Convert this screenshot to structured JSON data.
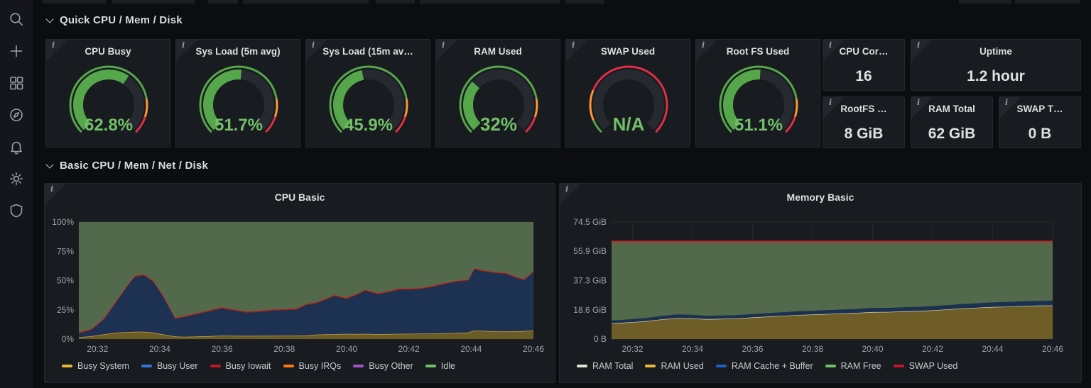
{
  "sidebar": {
    "icons": [
      "search",
      "plus",
      "dashboards",
      "explore",
      "alerting",
      "settings",
      "admin-shield"
    ]
  },
  "sections": [
    {
      "title": "Quick CPU / Mem / Disk"
    },
    {
      "title": "Basic CPU / Mem / Net / Disk"
    }
  ],
  "colors": {
    "gauge_green": "#56A64B",
    "gauge_value_green": "#73BF69",
    "threshold_orange": "#FF9830",
    "threshold_red": "#E02F44",
    "yellow": "#EAB839",
    "blue": "#3274D9",
    "dark_red": "#C4162A",
    "orange": "#FF780A",
    "purple": "#A352CC",
    "green": "#73BF69",
    "cream": "#E0E2CF",
    "panel_bg": "#181b1f",
    "page_bg": "#0b0d10"
  },
  "gauges": [
    {
      "title": "CPU Busy",
      "value": "62.8%",
      "percent": 62.8,
      "thresholds": [
        [
          0,
          80,
          "#56A64B"
        ],
        [
          80,
          90,
          "#FF9830"
        ],
        [
          90,
          100,
          "#E02F44"
        ]
      ]
    },
    {
      "title": "Sys Load (5m avg)",
      "value": "51.7%",
      "percent": 51.7,
      "thresholds": [
        [
          0,
          80,
          "#56A64B"
        ],
        [
          80,
          90,
          "#FF9830"
        ],
        [
          90,
          100,
          "#E02F44"
        ]
      ]
    },
    {
      "title": "Sys Load (15m av…",
      "value": "45.9%",
      "percent": 45.9,
      "thresholds": [
        [
          0,
          80,
          "#56A64B"
        ],
        [
          80,
          90,
          "#FF9830"
        ],
        [
          90,
          100,
          "#E02F44"
        ]
      ]
    },
    {
      "title": "RAM Used",
      "value": "32%",
      "percent": 32,
      "thresholds": [
        [
          0,
          80,
          "#56A64B"
        ],
        [
          80,
          90,
          "#FF9830"
        ],
        [
          90,
          100,
          "#E02F44"
        ]
      ]
    },
    {
      "title": "SWAP Used",
      "value": "N/A",
      "percent": null,
      "thresholds": [
        [
          0,
          8,
          "#56A64B"
        ],
        [
          8,
          25,
          "#FF9830"
        ],
        [
          25,
          100,
          "#E02F44"
        ]
      ]
    },
    {
      "title": "Root FS Used",
      "value": "51.1%",
      "percent": 51.1,
      "thresholds": [
        [
          0,
          80,
          "#56A64B"
        ],
        [
          80,
          90,
          "#FF9830"
        ],
        [
          90,
          100,
          "#E02F44"
        ]
      ]
    }
  ],
  "stats": [
    {
      "title": "CPU Cor…",
      "value": "16"
    },
    {
      "title": "Uptime",
      "value": "1.2 hour"
    },
    {
      "title": "RootFS …",
      "value": "8 GiB"
    },
    {
      "title": "RAM Total",
      "value": "62 GiB"
    },
    {
      "title": "SWAP T…",
      "value": "0 B"
    }
  ],
  "chart_data": [
    {
      "type": "area",
      "title": "CPU Basic",
      "stacked": true,
      "stack_total": 100,
      "ylim": [
        0,
        100
      ],
      "yticks": [
        [
          0,
          "0%"
        ],
        [
          25,
          "25%"
        ],
        [
          50,
          "50%"
        ],
        [
          75,
          "75%"
        ],
        [
          100,
          "100%"
        ]
      ],
      "xticks": [
        [
          32,
          "20:32"
        ],
        [
          34,
          "20:34"
        ],
        [
          36,
          "20:36"
        ],
        [
          38,
          "20:38"
        ],
        [
          40,
          "20:40"
        ],
        [
          42,
          "20:42"
        ],
        [
          44,
          "20:44"
        ],
        [
          46,
          "20:46"
        ]
      ],
      "x_domain": [
        31.4,
        46
      ],
      "x_minutes": [
        31.4,
        31.8,
        32.2,
        32.6,
        33.0,
        33.2,
        33.5,
        33.8,
        34.1,
        34.5,
        34.8,
        35.2,
        35.6,
        36.0,
        36.4,
        36.8,
        37.2,
        37.6,
        38.0,
        38.4,
        38.7,
        39.0,
        39.3,
        39.6,
        40.0,
        40.3,
        40.6,
        41.0,
        41.3,
        41.7,
        42.0,
        42.4,
        42.8,
        43.2,
        43.6,
        43.9,
        44.1,
        44.4,
        44.8,
        45.1,
        45.4,
        45.7,
        46.0
      ],
      "series": [
        {
          "name": "Busy System",
          "role": "stack",
          "fill": "#6b5b26",
          "stroke": "#d2a73e",
          "strokeW": 1.4,
          "values": [
            1.5,
            2.5,
            4,
            5.5,
            6,
            6.2,
            6.3,
            5.5,
            4,
            2.2,
            2,
            2.2,
            2.5,
            3,
            2.8,
            2.7,
            2.8,
            2.8,
            3,
            3,
            3.2,
            3.8,
            4,
            4.2,
            4.5,
            4.3,
            4.5,
            4.2,
            4.3,
            4.5,
            4.5,
            4.7,
            4.8,
            5,
            5.3,
            5.5,
            7.3,
            7,
            6.5,
            6.6,
            6.5,
            6.8,
            7.5
          ]
        },
        {
          "name": "Busy User",
          "role": "stack",
          "fill": "#1d3152",
          "stroke": null,
          "values": [
            3,
            5,
            12.5,
            26,
            40.5,
            46.8,
            47.7,
            43,
            32.5,
            14.8,
            16.5,
            18.8,
            21,
            23,
            21.2,
            19.6,
            20.2,
            21.2,
            21.5,
            22,
            25.8,
            26.2,
            29,
            32.3,
            29.5,
            32.7,
            36.5,
            33.8,
            35.2,
            37.5,
            37.5,
            37.8,
            39.7,
            42,
            43.7,
            44,
            52.2,
            50.5,
            49.5,
            48.9,
            46,
            43.2,
            49.5
          ]
        },
        {
          "name": "Busy Iowait",
          "role": "stack",
          "fill": "#6e2a26",
          "stroke": "#b23c33",
          "strokeW": 2,
          "values": 1.5
        },
        {
          "name": "Busy IRQs",
          "role": "stack",
          "fill": "none",
          "stroke": null,
          "values": 0
        },
        {
          "name": "Busy Other",
          "role": "stack",
          "fill": "none",
          "stroke": null,
          "values": 0
        },
        {
          "name": "Idle",
          "role": "stack",
          "fill": "#52694b",
          "stroke": null,
          "values": "remainder"
        }
      ],
      "legend": [
        [
          "Busy System",
          "#EAB839"
        ],
        [
          "Busy User",
          "#3274D9"
        ],
        [
          "Busy Iowait",
          "#C4162A"
        ],
        [
          "Busy IRQs",
          "#FF780A"
        ],
        [
          "Busy Other",
          "#A352CC"
        ],
        [
          "Idle",
          "#73BF69"
        ]
      ]
    },
    {
      "type": "area",
      "title": "Memory Basic",
      "stacked": true,
      "stack_total": 62,
      "ylim": [
        0,
        74.5
      ],
      "yticks": [
        [
          0,
          "0 B"
        ],
        [
          18.6,
          "18.6 GiB"
        ],
        [
          37.3,
          "37.3 GiB"
        ],
        [
          55.9,
          "55.9 GiB"
        ],
        [
          74.5,
          "74.5 GiB"
        ]
      ],
      "xticks": [
        [
          32,
          "20:32"
        ],
        [
          34,
          "20:34"
        ],
        [
          36,
          "20:36"
        ],
        [
          38,
          "20:38"
        ],
        [
          40,
          "20:40"
        ],
        [
          42,
          "20:42"
        ],
        [
          44,
          "20:44"
        ],
        [
          46,
          "20:46"
        ]
      ],
      "x_domain": [
        31.3,
        46
      ],
      "x_minutes": [
        31.3,
        32,
        32.5,
        33,
        33.5,
        34,
        34.5,
        35,
        35.5,
        36,
        36.5,
        37,
        37.5,
        38,
        38.5,
        39,
        39.5,
        40,
        40.5,
        41,
        41.5,
        42,
        42.5,
        43,
        43.5,
        44,
        44.5,
        45,
        45.5,
        46
      ],
      "series": [
        {
          "name": "RAM Used",
          "role": "stack",
          "fill": "#6f5d27",
          "stroke": "#d9d3ab",
          "strokeW": 1.4,
          "values": [
            10.0,
            10.8,
            11.5,
            12.6,
            13.3,
            13.1,
            12.7,
            12.9,
            13.1,
            13.8,
            14.3,
            14.8,
            15.3,
            15.6,
            16.0,
            16.3,
            16.7,
            17.2,
            17.3,
            17.6,
            17.9,
            18.3,
            18.9,
            19.5,
            20.0,
            20.4,
            20.7,
            21.0,
            21.3,
            21.4
          ]
        },
        {
          "name": "RAM Cache + Buffer",
          "role": "stack",
          "fill": "#1b3150",
          "stroke": null,
          "values": [
            1.8,
            1.9,
            2.0,
            2.2,
            2.4,
            2.3,
            2.1,
            2.1,
            2.1,
            2.1,
            2.2,
            2.2,
            2.3,
            2.4,
            2.4,
            2.5,
            2.5,
            2.6,
            2.5,
            2.6,
            2.6,
            2.7,
            2.7,
            2.8,
            2.8,
            2.9,
            2.9,
            3.0,
            3.0,
            3.1
          ]
        },
        {
          "name": "RAM Free",
          "role": "stack",
          "fill": "#52694b",
          "stroke": null,
          "values": "remainder"
        },
        {
          "name": "RAM Total",
          "role": "line",
          "stroke": "#e0e2cf",
          "strokeW": 1.6,
          "values": 62
        },
        {
          "name": "SWAP Used",
          "role": "stack-line",
          "stroke": "#b5332c",
          "strokeW": 2.4,
          "values": 0
        }
      ],
      "legend": [
        [
          "RAM Total",
          "#e0e2cf"
        ],
        [
          "RAM Used",
          "#EAB839"
        ],
        [
          "RAM Cache + Buffer",
          "#1F60C4"
        ],
        [
          "RAM Free",
          "#73BF69"
        ],
        [
          "SWAP Used",
          "#C4162A"
        ]
      ]
    }
  ]
}
